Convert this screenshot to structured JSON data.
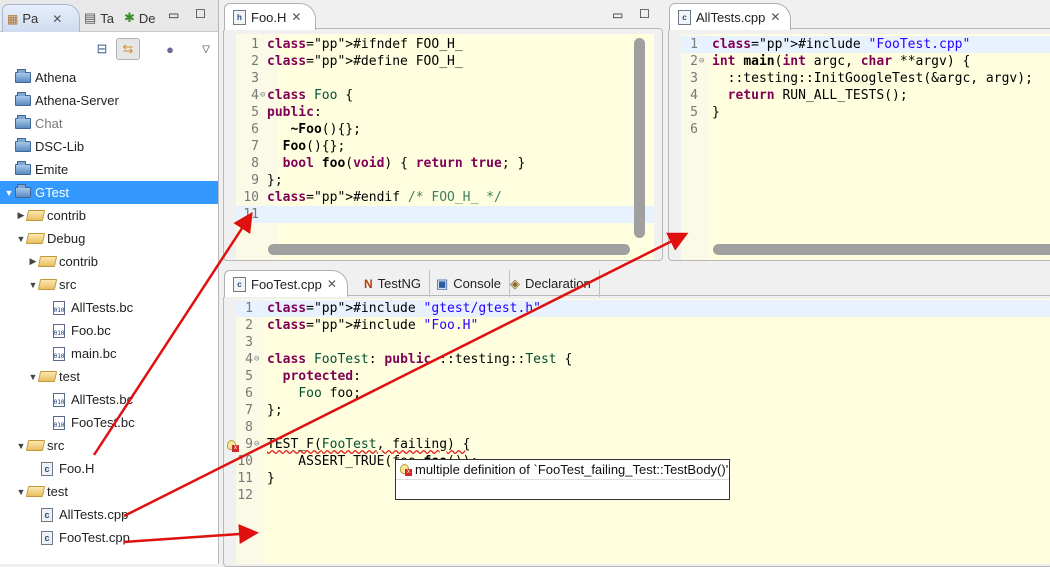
{
  "left_panel": {
    "tabs": [
      {
        "label": "Pa",
        "icon": "package-explorer-icon",
        "active": true
      },
      {
        "label": "Ta",
        "icon": "task-list-icon",
        "active": false
      },
      {
        "label": "De",
        "icon": "debug-icon",
        "active": false
      }
    ],
    "toolbar": {
      "collapse_all": "collapse-all-icon",
      "link_with_editor": "link-with-editor-icon",
      "view_menu": "view-menu-icon"
    },
    "tree": [
      {
        "label": "Athena",
        "depth": 0,
        "icon": "project",
        "twisty": ""
      },
      {
        "label": "Athena-Server",
        "depth": 0,
        "icon": "project",
        "twisty": ""
      },
      {
        "label": "Chat",
        "depth": 0,
        "icon": "project",
        "twisty": ""
      },
      {
        "label": "DSC-Lib",
        "depth": 0,
        "icon": "project",
        "twisty": ""
      },
      {
        "label": "Emite",
        "depth": 0,
        "icon": "project",
        "twisty": ""
      },
      {
        "label": "GTest",
        "depth": 0,
        "icon": "cpp-project-error",
        "twisty": "▼",
        "selected": true
      },
      {
        "label": "contrib",
        "depth": 1,
        "icon": "folder",
        "twisty": "▶"
      },
      {
        "label": "Debug",
        "depth": 1,
        "icon": "folder",
        "twisty": "▼"
      },
      {
        "label": "contrib",
        "depth": 2,
        "icon": "folder",
        "twisty": "▶"
      },
      {
        "label": "src",
        "depth": 2,
        "icon": "folder",
        "twisty": "▼"
      },
      {
        "label": "AllTests.bc",
        "depth": 3,
        "icon": "binary",
        "twisty": ""
      },
      {
        "label": "Foo.bc",
        "depth": 3,
        "icon": "binary",
        "twisty": ""
      },
      {
        "label": "main.bc",
        "depth": 3,
        "icon": "binary",
        "twisty": ""
      },
      {
        "label": "test",
        "depth": 2,
        "icon": "folder",
        "twisty": "▼"
      },
      {
        "label": "AllTests.bc",
        "depth": 3,
        "icon": "binary",
        "twisty": ""
      },
      {
        "label": "FooTest.bc",
        "depth": 3,
        "icon": "binary",
        "twisty": ""
      },
      {
        "label": "src",
        "depth": 1,
        "icon": "folder",
        "twisty": "▼"
      },
      {
        "label": "Foo.H",
        "depth": 2,
        "icon": "c-source",
        "twisty": ""
      },
      {
        "label": "test",
        "depth": 1,
        "icon": "folder-error",
        "twisty": "▼"
      },
      {
        "label": "AllTests.cpp",
        "depth": 2,
        "icon": "c-source",
        "twisty": ""
      },
      {
        "label": "FooTest.cpp",
        "depth": 2,
        "icon": "c-source",
        "twisty": ""
      }
    ]
  },
  "editor_foo_h": {
    "tab": {
      "label": "Foo.H",
      "icon": "header-file-icon"
    },
    "lines": [
      {
        "n": "1",
        "code": "#ifndef FOO_H_"
      },
      {
        "n": "2",
        "code": "#define FOO_H_"
      },
      {
        "n": "3",
        "code": ""
      },
      {
        "n": "4",
        "code": "class Foo {",
        "fold": true
      },
      {
        "n": "5",
        "code": "public:"
      },
      {
        "n": "6",
        "code": "   ~Foo(){};"
      },
      {
        "n": "7",
        "code": "  Foo(){};"
      },
      {
        "n": "8",
        "code": "  bool foo(void) { return true; }"
      },
      {
        "n": "9",
        "code": "};"
      },
      {
        "n": "10",
        "code": "#endif /* FOO_H_ */"
      },
      {
        "n": "11",
        "code": "",
        "current": true
      }
    ]
  },
  "editor_alltests": {
    "tab": {
      "label": "AllTests.cpp",
      "icon": "cpp-file-icon"
    },
    "lines": [
      {
        "n": "1",
        "code": "#include \"FooTest.cpp\"",
        "current": true
      },
      {
        "n": "2",
        "code": "int main(int argc, char **argv) {",
        "fold": true
      },
      {
        "n": "3",
        "code": "  ::testing::InitGoogleTest(&argc, argv);"
      },
      {
        "n": "4",
        "code": "  return RUN_ALL_TESTS();"
      },
      {
        "n": "5",
        "code": "}"
      },
      {
        "n": "6",
        "code": ""
      }
    ]
  },
  "editor_footest": {
    "tabs": [
      {
        "label": "FooTest.cpp",
        "icon": "cpp-file-icon",
        "active": true
      },
      {
        "label": "TestNG",
        "icon": "testng-icon"
      },
      {
        "label": "Console",
        "icon": "console-icon"
      },
      {
        "label": "Declaration",
        "icon": "declaration-icon"
      }
    ],
    "lines": [
      {
        "n": "1",
        "code": "#include \"gtest/gtest.h\"",
        "current": true
      },
      {
        "n": "2",
        "code": "#include \"Foo.H\""
      },
      {
        "n": "3",
        "code": ""
      },
      {
        "n": "4",
        "code": "class FooTest: public ::testing::Test {",
        "fold": true
      },
      {
        "n": "5",
        "code": "  protected:"
      },
      {
        "n": "6",
        "code": "    Foo foo;"
      },
      {
        "n": "7",
        "code": "};"
      },
      {
        "n": "8",
        "code": ""
      },
      {
        "n": "9",
        "code": "TEST_F(FooTest, failing) {",
        "fold": true,
        "error": true
      },
      {
        "n": "10",
        "code": "    ASSERT_TRUE(foo.foo());"
      },
      {
        "n": "11",
        "code": "}"
      },
      {
        "n": "12",
        "code": ""
      }
    ],
    "tooltip": "multiple definition of `FooTest_failing_Test::TestBody()'"
  },
  "colors": {
    "selection": "#3399ff",
    "editor_bg": "#ffffe0",
    "current_line": "#e8f2fe",
    "keyword": "#7f0055",
    "string": "#2a00ff",
    "type": "#005032",
    "comment": "#3f7f5f",
    "annotation_arrow": "#e01010"
  }
}
